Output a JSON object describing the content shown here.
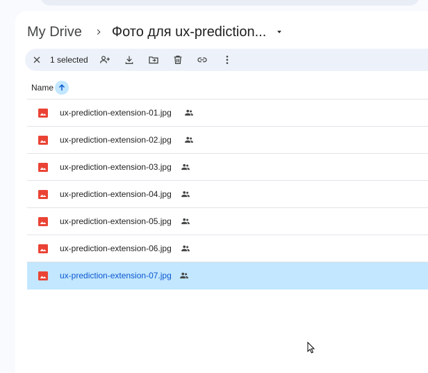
{
  "breadcrumb": {
    "root": "My Drive",
    "current": "Фото для ux-prediction..."
  },
  "toolbar": {
    "selected_count": "1 selected",
    "actions": [
      "close-icon",
      "share-icon",
      "download-icon",
      "move-icon",
      "delete-icon",
      "link-icon",
      "more-icon"
    ]
  },
  "list": {
    "column_name": "Name",
    "sort": "ascending",
    "files": [
      {
        "name": "ux-prediction-extension-01.jpg",
        "selected": false
      },
      {
        "name": "ux-prediction-extension-02.jpg",
        "selected": false
      },
      {
        "name": "ux-prediction-extension-03.jpg",
        "selected": false
      },
      {
        "name": "ux-prediction-extension-04.jpg",
        "selected": false
      },
      {
        "name": "ux-prediction-extension-05.jpg",
        "selected": false
      },
      {
        "name": "ux-prediction-extension-06.jpg",
        "selected": false
      },
      {
        "name": "ux-prediction-extension-07.jpg",
        "selected": true
      }
    ]
  },
  "colors": {
    "accent": "#0b57d0",
    "selected_bg": "#c2e7ff",
    "image_icon": "#ea4335",
    "toolbar_bg": "#edf2fa"
  }
}
